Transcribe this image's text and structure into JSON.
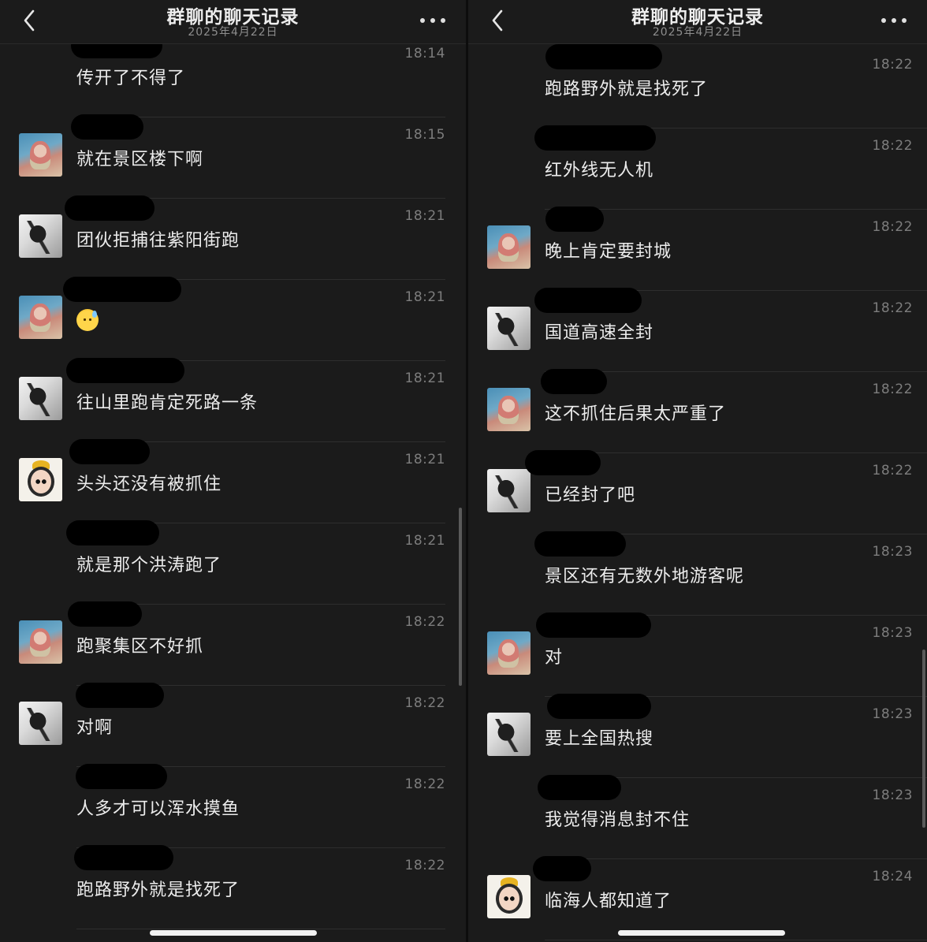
{
  "colors": {
    "background": "#1b1b1b",
    "text": "#ececec",
    "time": "#7d7d7d",
    "redaction": "#000000"
  },
  "left": {
    "header": {
      "title": "群聊的聊天记录",
      "subtitle": "2025年4月22日",
      "back_icon": "chevron-left-icon",
      "more_icon": "more-dots-icon"
    },
    "messages": [
      {
        "time": "18:14",
        "text": "传开了不得了",
        "avatar": "none"
      },
      {
        "time": "18:15",
        "text": "就在景区楼下啊",
        "avatar": "a"
      },
      {
        "time": "18:21",
        "text": "团伙拒捕往紫阳街跑",
        "avatar": "b"
      },
      {
        "time": "18:21",
        "text": "",
        "avatar": "a",
        "emoji": "sweat-smile-emoji"
      },
      {
        "time": "18:21",
        "text": "往山里跑肯定死路一条",
        "avatar": "b"
      },
      {
        "time": "18:21",
        "text": "头头还没有被抓住",
        "avatar": "c"
      },
      {
        "time": "18:21",
        "text": "就是那个洪涛跑了",
        "avatar": "none"
      },
      {
        "time": "18:22",
        "text": "跑聚集区不好抓",
        "avatar": "a"
      },
      {
        "time": "18:22",
        "text": "对啊",
        "avatar": "b"
      },
      {
        "time": "18:22",
        "text": "人多才可以浑水摸鱼",
        "avatar": "none"
      },
      {
        "time": "18:22",
        "text": "跑路野外就是找死了",
        "avatar": "none"
      }
    ]
  },
  "right": {
    "header": {
      "title": "群聊的聊天记录",
      "subtitle": "2025年4月22日",
      "back_icon": "chevron-left-icon",
      "more_icon": "more-dots-icon"
    },
    "messages": [
      {
        "time": "18:22",
        "text": "跑路野外就是找死了",
        "avatar": "none"
      },
      {
        "time": "18:22",
        "text": "红外线无人机",
        "avatar": "none"
      },
      {
        "time": "18:22",
        "text": "晚上肯定要封城",
        "avatar": "a"
      },
      {
        "time": "18:22",
        "text": "国道高速全封",
        "avatar": "b"
      },
      {
        "time": "18:22",
        "text": "这不抓住后果太严重了",
        "avatar": "a"
      },
      {
        "time": "18:22",
        "text": "已经封了吧",
        "avatar": "b"
      },
      {
        "time": "18:23",
        "text": "景区还有无数外地游客呢",
        "avatar": "none"
      },
      {
        "time": "18:23",
        "text": "对",
        "avatar": "a"
      },
      {
        "time": "18:23",
        "text": "要上全国热搜",
        "avatar": "b"
      },
      {
        "time": "18:23",
        "text": "我觉得消息封不住",
        "avatar": "none"
      },
      {
        "time": "18:24",
        "text": "临海人都知道了",
        "avatar": "c"
      }
    ]
  }
}
